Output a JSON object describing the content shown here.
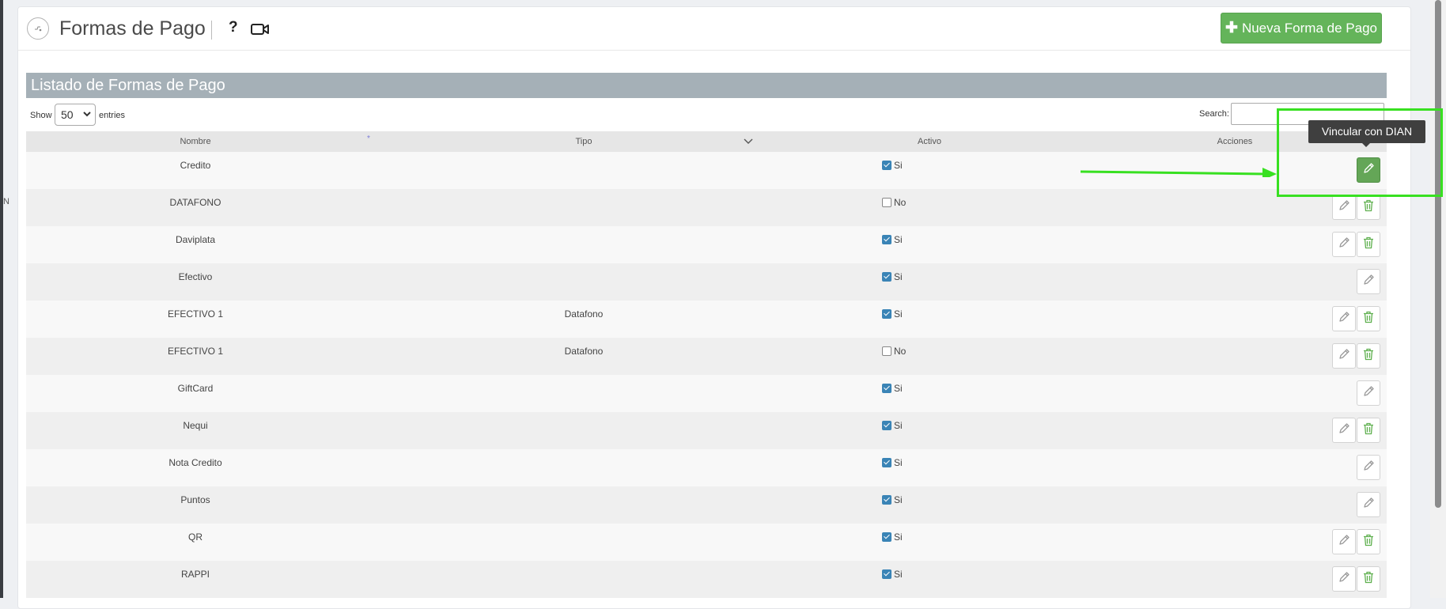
{
  "header": {
    "title": "Formas de Pago",
    "help_label": "?",
    "new_button_label": "Nueva Forma de Pago"
  },
  "list": {
    "title": "Listado de Formas de Pago",
    "show_label": "Show",
    "entries_value": "50",
    "entries_label": "entries",
    "search_label": "Search:",
    "search_value": ""
  },
  "table": {
    "columns": [
      "Nombre",
      "Tipo",
      "Activo",
      "Acciones"
    ],
    "rows": [
      {
        "nombre": "Credito",
        "tipo": "",
        "activo": "Si",
        "checked": true,
        "edit": true,
        "delete": false,
        "highlighted": true
      },
      {
        "nombre": "DATAFONO",
        "tipo": "",
        "activo": "No",
        "checked": false,
        "edit": true,
        "delete": true
      },
      {
        "nombre": "Daviplata",
        "tipo": "",
        "activo": "Si",
        "checked": true,
        "edit": true,
        "delete": true
      },
      {
        "nombre": "Efectivo",
        "tipo": "",
        "activo": "Si",
        "checked": true,
        "edit": true,
        "delete": false
      },
      {
        "nombre": "EFECTIVO 1",
        "tipo": "Datafono",
        "activo": "Si",
        "checked": true,
        "edit": true,
        "delete": true
      },
      {
        "nombre": "EFECTIVO 1",
        "tipo": "Datafono",
        "activo": "No",
        "checked": false,
        "edit": true,
        "delete": true
      },
      {
        "nombre": "GiftCard",
        "tipo": "",
        "activo": "Si",
        "checked": true,
        "edit": true,
        "delete": false
      },
      {
        "nombre": "Nequi",
        "tipo": "",
        "activo": "Si",
        "checked": true,
        "edit": true,
        "delete": true
      },
      {
        "nombre": "Nota Credito",
        "tipo": "",
        "activo": "Si",
        "checked": true,
        "edit": true,
        "delete": false
      },
      {
        "nombre": "Puntos",
        "tipo": "",
        "activo": "Si",
        "checked": true,
        "edit": true,
        "delete": false
      },
      {
        "nombre": "QR",
        "tipo": "",
        "activo": "Si",
        "checked": true,
        "edit": true,
        "delete": true
      },
      {
        "nombre": "RAPPI",
        "tipo": "",
        "activo": "Si",
        "checked": true,
        "edit": true,
        "delete": true
      }
    ]
  },
  "tooltip": {
    "text": "Vincular con DIAN"
  },
  "side_letter": "N",
  "colors": {
    "accent_green": "#64b45a",
    "list_bar": "#a5b0b7",
    "highlight": "#38e021",
    "checkbox": "#3a84b6"
  }
}
